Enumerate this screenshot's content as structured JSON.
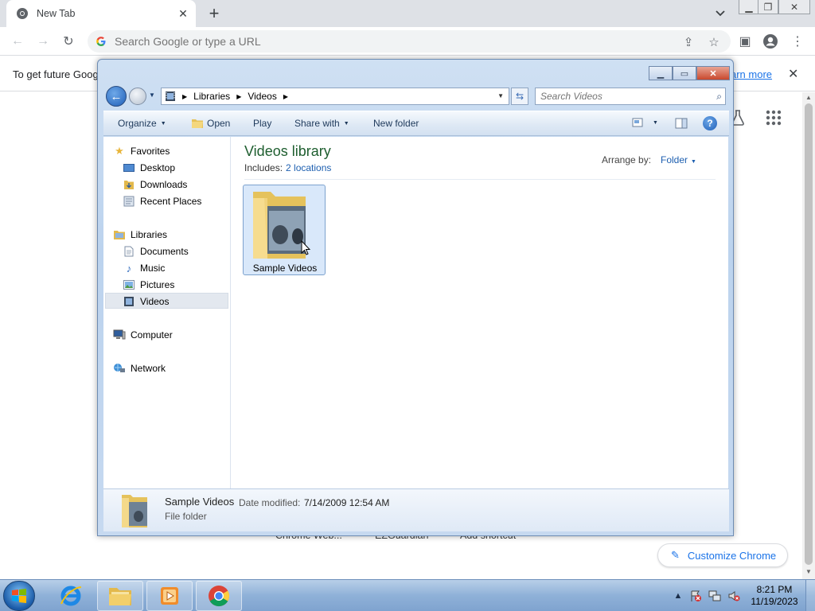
{
  "browser": {
    "tab_title": "New Tab",
    "omnibox_placeholder": "Search Google or type a URL",
    "infobar_text": "To get future Goog",
    "infobar_link": "arn more",
    "shortcuts": [
      "Chrome Web...",
      "EZGuardian",
      "Add shortcut"
    ],
    "customize_label": "Customize Chrome"
  },
  "explorer": {
    "breadcrumb": [
      "Libraries",
      "Videos"
    ],
    "search_placeholder": "Search Videos",
    "commands": {
      "organize": "Organize",
      "open": "Open",
      "play": "Play",
      "share_with": "Share with",
      "new_folder": "New folder"
    },
    "nav": {
      "favorites_header": "Favorites",
      "favorites": [
        "Desktop",
        "Downloads",
        "Recent Places"
      ],
      "libraries_header": "Libraries",
      "libraries": [
        "Documents",
        "Music",
        "Pictures",
        "Videos"
      ],
      "computer": "Computer",
      "network": "Network",
      "selected": "Videos"
    },
    "library": {
      "title": "Videos library",
      "includes_label": "Includes:",
      "includes_link": "2 locations",
      "arrange_label": "Arrange by:",
      "arrange_value": "Folder"
    },
    "items": [
      {
        "name": "Sample Videos"
      }
    ],
    "details": {
      "name": "Sample Videos",
      "modified_label": "Date modified:",
      "modified_value": "7/14/2009 12:54 AM",
      "type": "File folder"
    }
  },
  "taskbar": {
    "time": "8:21 PM",
    "date": "11/19/2023"
  },
  "colors": {
    "chrome_tabstrip": "#dee1e6",
    "link_blue": "#1a73e8",
    "library_title_green": "#1e5e2f",
    "selection_blue": "#d9e8fa"
  }
}
